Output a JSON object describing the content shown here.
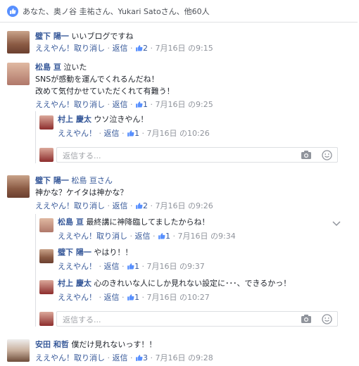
{
  "likes": {
    "summary": "あなた、奥ノ谷 圭祐さん、Yukari Satoさん、他60人"
  },
  "comments": [
    {
      "name": "璧下 陽一",
      "text": "いいブログですね",
      "actions": {
        "like": "ええやん！",
        "unlike": "取り消し",
        "reply": "返信",
        "count": "2",
        "date": "7月16日 の9:15"
      }
    },
    {
      "name": "松島 亘",
      "lines": [
        "泣いた",
        "SNSが感動を運んでくれるんだね！",
        "改めて気付かせていただくれて有難う！"
      ],
      "actions": {
        "like": "ええやん！",
        "unlike": "取り消し",
        "reply": "返信",
        "count": "1",
        "date": "7月16日 の9:25"
      },
      "replies": [
        {
          "name": "村上 慶太",
          "text": "ウソ泣きやん！",
          "actions": {
            "like": "ええやん！",
            "reply": "返信",
            "count": "1",
            "date": "7月16日 の10:26"
          }
        }
      ]
    },
    {
      "name": "璧下 陽一",
      "mention": "松島 亘さん",
      "text": "神かな？ケイタは神かな？",
      "actions": {
        "like": "ええやん！",
        "unlike": "取り消し",
        "reply": "返信",
        "count": "2",
        "date": "7月16日 の9:26"
      },
      "replies": [
        {
          "name": "松島 亘",
          "text": "最終講に神降臨してましたからね！",
          "actions": {
            "like": "ええやん！",
            "unlike": "取り消し",
            "reply": "返信",
            "count": "1",
            "date": "7月16日 の9:34"
          }
        },
        {
          "name": "璧下 陽一",
          "text": "やはり！！",
          "actions": {
            "like": "ええやん！",
            "reply": "返信",
            "count": "1",
            "date": "7月16日 の9:37"
          }
        },
        {
          "name": "村上 慶太",
          "text": "心のきれいな人にしか見れない設定に･･･、できるかっ！",
          "actions": {
            "like": "ええやん！",
            "reply": "返信",
            "count": "1",
            "date": "7月16日 の10:27"
          }
        }
      ]
    },
    {
      "name": "安田 和哲",
      "text": "僕だけ見れないっす！！",
      "actions": {
        "like": "ええやん！",
        "unlike": "取り消し",
        "reply": "返信",
        "count": "3",
        "date": "7月16日 の9:28"
      }
    }
  ],
  "reply_box": {
    "placeholder": "返信する..."
  },
  "colors": {
    "link": "#365899",
    "meta": "#90949c",
    "like_blue": "#5890ff"
  }
}
